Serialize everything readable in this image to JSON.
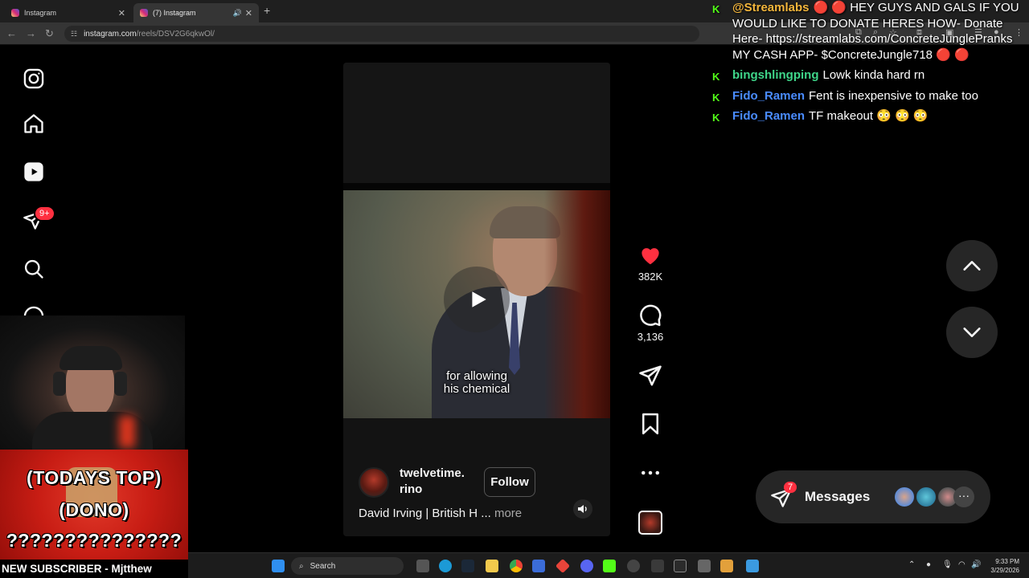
{
  "browser": {
    "tabs": [
      {
        "title": "Instagram",
        "active": false
      },
      {
        "title": "(7) Instagram",
        "active": true
      }
    ],
    "url_host": "instagram.com",
    "url_path": "/reels/DSV2G6qkwOl/",
    "new_tab_symbol": "+"
  },
  "ig_nav": {
    "icons": [
      "instagram-logo-icon",
      "home-icon",
      "reels-icon",
      "direct-messages-icon",
      "search-icon",
      "explore-icon"
    ],
    "messages_badge": "9+"
  },
  "reel": {
    "video_caption_line1": "for allowing",
    "video_caption_line2": "his chemical",
    "username_line1": "twelvetime.",
    "username_line2": "rino",
    "follow_label": "Follow",
    "description": "David Irving | British H",
    "ellipsis": "...",
    "more_label": "more"
  },
  "actions": {
    "likes": "382K",
    "comments": "3,136",
    "liked": true,
    "like_color": "#ff3040"
  },
  "messages_pill": {
    "label": "Messages",
    "badge": "7",
    "more_symbol": "···"
  },
  "chat": {
    "platform_mark": "K",
    "messages": [
      {
        "user": "@Streamlabs",
        "user_color": "#f4b63b",
        "text": "🔴 🔴 HEY GUYS AND GALS IF YOU WOULD LIKE TO DONATE HERES HOW- Donate Here- https://streamlabs.com/ConcreteJunglePranks MY CASH APP- $ConcreteJungle718 🔴 🔴"
      },
      {
        "user": "bingshlingping",
        "user_color": "#3fd68a",
        "text": "Lowk kinda hard rn"
      },
      {
        "user": "Fido_Ramen",
        "user_color": "#4a8cff",
        "text": "Fent is inexpensive to make too"
      },
      {
        "user": "Fido_Ramen",
        "user_color": "#4a8cff",
        "text": "TF makeout 😳 😳 😳"
      }
    ]
  },
  "stream_overlay": {
    "dono_line1": "(TODAYS TOP)",
    "dono_line2": "(DONO)",
    "dono_line3": "???????????????",
    "new_subscriber": "NEW SUBSCRIBER - Mjtthew"
  },
  "taskbar": {
    "search_placeholder": "Search",
    "time": "9:33 PM",
    "date": "3/29/2026"
  }
}
